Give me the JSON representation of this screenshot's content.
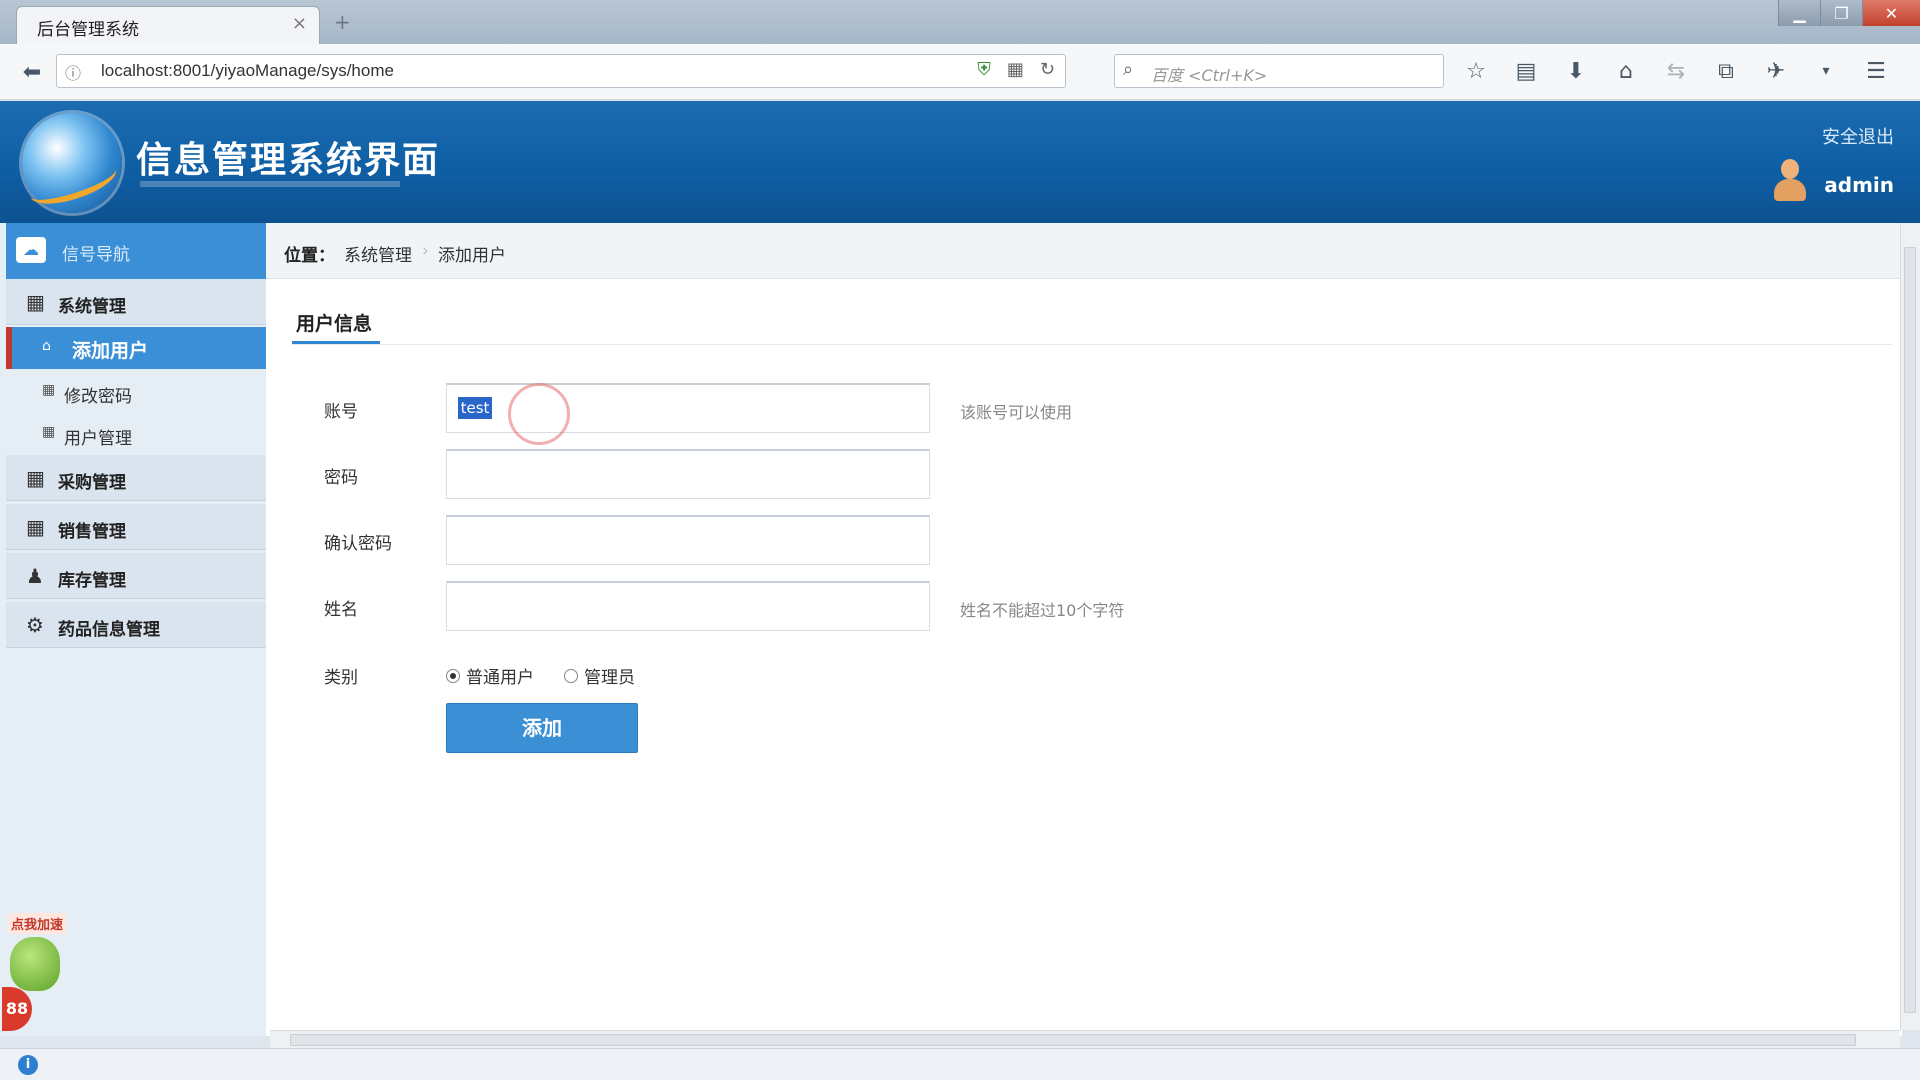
{
  "browser": {
    "tab_title": "后台管理系统",
    "tab_close": "×",
    "new_tab": "+",
    "url": "localhost:8001/yiyaoManage/sys/home",
    "search_placeholder": "百度 <Ctrl+K>",
    "window_buttons": [
      "▁",
      "❐",
      "✕"
    ]
  },
  "header": {
    "title": "信息管理系统界面",
    "logout": "安全退出",
    "username": "admin"
  },
  "sidebar": {
    "top_label": "信号导航",
    "groups": [
      {
        "label": "系统管理",
        "icon": "calendar-icon"
      },
      {
        "label": "采购管理",
        "icon": "calendar-icon"
      },
      {
        "label": "销售管理",
        "icon": "calendar-icon"
      },
      {
        "label": "库存管理",
        "icon": "user-icon"
      },
      {
        "label": "药品信息管理",
        "icon": "gear-icon"
      }
    ],
    "items": [
      {
        "label": "添加用户",
        "active": true
      },
      {
        "label": "修改密码",
        "active": false
      },
      {
        "label": "用户管理",
        "active": false
      }
    ],
    "promo": {
      "tag": "点我加速",
      "count": "88"
    }
  },
  "breadcrumb": {
    "prefix": "位置：",
    "level1": "系统管理",
    "separator": "›",
    "level2": "添加用户"
  },
  "form": {
    "section_title": "用户信息",
    "fields": [
      {
        "label": "账号",
        "value": "",
        "selected_text": "test",
        "hint": "该账号可以使用"
      },
      {
        "label": "密码",
        "value": "",
        "hint": ""
      },
      {
        "label": "确认密码",
        "value": "",
        "hint": ""
      },
      {
        "label": "姓名",
        "value": "",
        "hint": "姓名不能超过10个字符"
      }
    ],
    "type_label": "类别",
    "type_options": [
      {
        "label": "普通用户",
        "checked": true
      },
      {
        "label": "管理员",
        "checked": false
      }
    ],
    "submit_label": "添加"
  },
  "colors": {
    "header_bg": "#0f5fa5",
    "accent": "#3b8fd6",
    "active_marker": "#c0392b"
  }
}
